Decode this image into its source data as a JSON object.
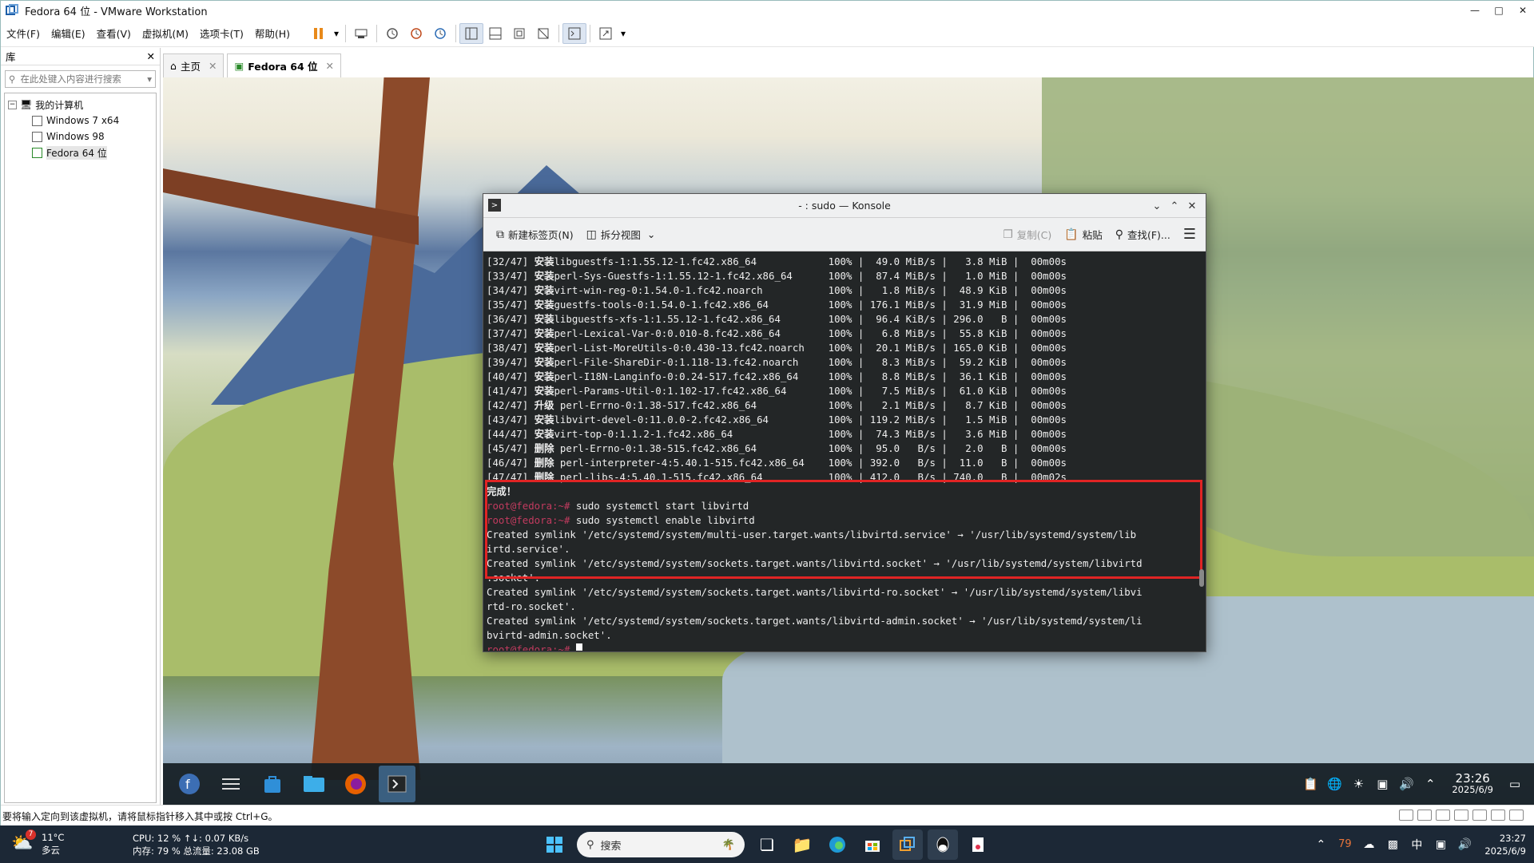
{
  "window": {
    "title": "Fedora 64 位 - VMware Workstation"
  },
  "menu": [
    "文件(F)",
    "编辑(E)",
    "查看(V)",
    "虚拟机(M)",
    "选项卡(T)",
    "帮助(H)"
  ],
  "library": {
    "header": "库",
    "search_placeholder": "在此处键入内容进行搜索",
    "root": "我的计算机",
    "vms": [
      "Windows 7 x64",
      "Windows 98",
      "Fedora 64 位"
    ]
  },
  "tabs": [
    {
      "label": "主页"
    },
    {
      "label": "Fedora 64 位"
    }
  ],
  "konsole": {
    "title": "- : sudo — Konsole",
    "toolbar": {
      "new_tab": "新建标签页(N)",
      "split": "拆分视图",
      "copy": "复制(C)",
      "paste": "粘贴",
      "find": "查找(F)..."
    },
    "packages": [
      {
        "idx": "[32/47]",
        "act": "安装",
        "name": "libguestfs-1:1.55.12-1.fc42.x86_64",
        "pct": "100%",
        "speed": "49.0 MiB/s",
        "size": "3.8 MiB",
        "time": "00m00s"
      },
      {
        "idx": "[33/47]",
        "act": "安装",
        "name": "perl-Sys-Guestfs-1:1.55.12-1.fc42.x86_64",
        "pct": "100%",
        "speed": "87.4 MiB/s",
        "size": "1.0 MiB",
        "time": "00m00s"
      },
      {
        "idx": "[34/47]",
        "act": "安装",
        "name": "virt-win-reg-0:1.54.0-1.fc42.noarch",
        "pct": "100%",
        "speed": "1.8 MiB/s",
        "size": "48.9 KiB",
        "time": "00m00s"
      },
      {
        "idx": "[35/47]",
        "act": "安装",
        "name": "guestfs-tools-0:1.54.0-1.fc42.x86_64",
        "pct": "100%",
        "speed": "176.1 MiB/s",
        "size": "31.9 MiB",
        "time": "00m00s"
      },
      {
        "idx": "[36/47]",
        "act": "安装",
        "name": "libguestfs-xfs-1:1.55.12-1.fc42.x86_64",
        "pct": "100%",
        "speed": "96.4 KiB/s",
        "size": "296.0   B",
        "time": "00m00s"
      },
      {
        "idx": "[37/47]",
        "act": "安装",
        "name": "perl-Lexical-Var-0:0.010-8.fc42.x86_64",
        "pct": "100%",
        "speed": "6.8 MiB/s",
        "size": "55.8 KiB",
        "time": "00m00s"
      },
      {
        "idx": "[38/47]",
        "act": "安装",
        "name": "perl-List-MoreUtils-0:0.430-13.fc42.noarch",
        "pct": "100%",
        "speed": "20.1 MiB/s",
        "size": "165.0 KiB",
        "time": "00m00s"
      },
      {
        "idx": "[39/47]",
        "act": "安装",
        "name": "perl-File-ShareDir-0:1.118-13.fc42.noarch",
        "pct": "100%",
        "speed": "8.3 MiB/s",
        "size": "59.2 KiB",
        "time": "00m00s"
      },
      {
        "idx": "[40/47]",
        "act": "安装",
        "name": "perl-I18N-Langinfo-0:0.24-517.fc42.x86_64",
        "pct": "100%",
        "speed": "8.8 MiB/s",
        "size": "36.1 KiB",
        "time": "00m00s"
      },
      {
        "idx": "[41/47]",
        "act": "安装",
        "name": "perl-Params-Util-0:1.102-17.fc42.x86_64",
        "pct": "100%",
        "speed": "7.5 MiB/s",
        "size": "61.0 KiB",
        "time": "00m00s"
      },
      {
        "idx": "[42/47]",
        "act": "升级",
        "name": " perl-Errno-0:1.38-517.fc42.x86_64",
        "pct": "100%",
        "speed": "2.1 MiB/s",
        "size": "8.7 KiB",
        "time": "00m00s"
      },
      {
        "idx": "[43/47]",
        "act": "安装",
        "name": "libvirt-devel-0:11.0.0-2.fc42.x86_64",
        "pct": "100%",
        "speed": "119.2 MiB/s",
        "size": "1.5 MiB",
        "time": "00m00s"
      },
      {
        "idx": "[44/47]",
        "act": "安装",
        "name": "virt-top-0:1.1.2-1.fc42.x86_64",
        "pct": "100%",
        "speed": "74.3 MiB/s",
        "size": "3.6 MiB",
        "time": "00m00s"
      },
      {
        "idx": "[45/47]",
        "act": "删除",
        "name": " perl-Errno-0:1.38-515.fc42.x86_64",
        "pct": "100%",
        "speed": "95.0   B/s",
        "size": "2.0   B",
        "time": "00m00s"
      },
      {
        "idx": "[46/47]",
        "act": "删除",
        "name": " perl-interpreter-4:5.40.1-515.fc42.x86_64",
        "pct": "100%",
        "speed": "392.0   B/s",
        "size": "11.0   B",
        "time": "00m00s"
      },
      {
        "idx": "[47/47]",
        "act": "删除",
        "name": " perl-libs-4:5.40.1-515.fc42.x86_64",
        "pct": "100%",
        "speed": "412.0   B/s",
        "size": "740.0   B",
        "time": "00m02s"
      }
    ],
    "done": "完成！",
    "prompt": "root@fedora:~#",
    "cmd1": "sudo systemctl start libvirtd",
    "cmd2": "sudo systemctl enable libvirtd",
    "output": [
      "Created symlink '/etc/systemd/system/multi-user.target.wants/libvirtd.service' → '/usr/lib/systemd/system/lib",
      "irtd.service'.",
      "Created symlink '/etc/systemd/system/sockets.target.wants/libvirtd.socket' → '/usr/lib/systemd/system/libvirtd",
      ".socket'.",
      "Created symlink '/etc/systemd/system/sockets.target.wants/libvirtd-ro.socket' → '/usr/lib/systemd/system/libvi",
      "rtd-ro.socket'.",
      "Created symlink '/etc/systemd/system/sockets.target.wants/libvirtd-admin.socket' → '/usr/lib/systemd/system/li",
      "bvirtd-admin.socket'."
    ],
    "prompt_last": "root@fedora:~#",
    "highlight_color": "#e02424"
  },
  "guest_taskbar": {
    "time": "23:26",
    "date": "2025/6/9"
  },
  "vm_status": "要将输入定向到该虚拟机，请将鼠标指针移入其中或按 Ctrl+G。",
  "host_taskbar": {
    "weather_temp": "11°C",
    "weather_desc": "多云",
    "weather_badge": "7",
    "cpu": "CPU: 12 %  ↑↓: 0.07 KB/s",
    "mem": "内存: 79 %  总流量: 23.08 GB",
    "search": "搜索",
    "tray_temp": "79",
    "ime": "中",
    "time": "23:27",
    "date": "2025/6/9"
  }
}
